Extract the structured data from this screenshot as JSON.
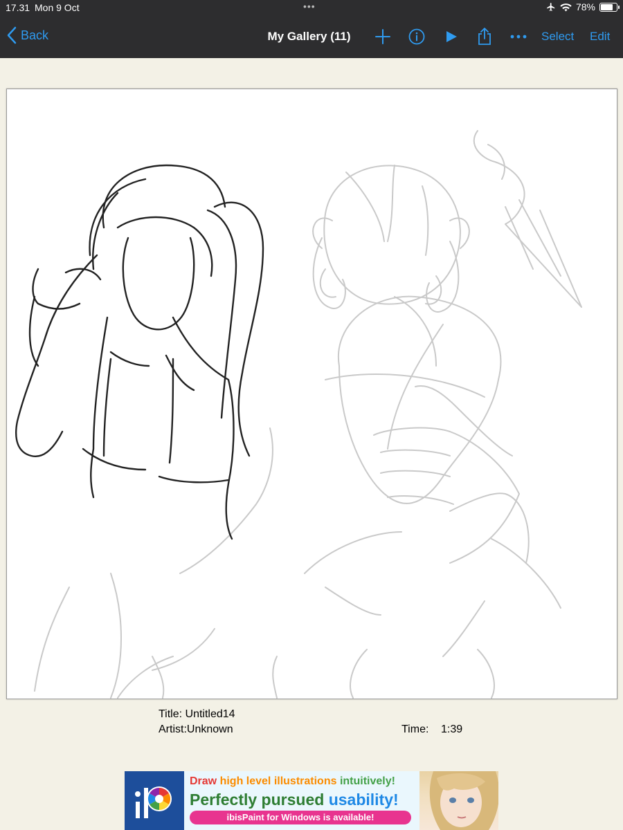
{
  "status_bar": {
    "time": "17.31",
    "date": "Mon 9 Oct",
    "dots": "•••",
    "battery_percent": "78%",
    "battery_level": 0.78
  },
  "nav": {
    "back_label": "Back",
    "title": "My Gallery (11)",
    "icons": [
      "plus-icon",
      "info-icon",
      "play-icon",
      "share-icon",
      "more-icon"
    ],
    "select_label": "Select",
    "edit_label": "Edit",
    "accent_color": "#2f9bf0"
  },
  "artwork": {
    "title_line": "Title: Untitled14",
    "artist_line": "Artist:Unknown",
    "time_label": "Time:",
    "time_value": "1:39"
  },
  "ad": {
    "line1": [
      "Draw ",
      "high level illustrations ",
      "intuitively!"
    ],
    "line2": [
      "Perfectly pursued ",
      "usability!"
    ],
    "pill": "ibisPaint for Windows is available!"
  }
}
